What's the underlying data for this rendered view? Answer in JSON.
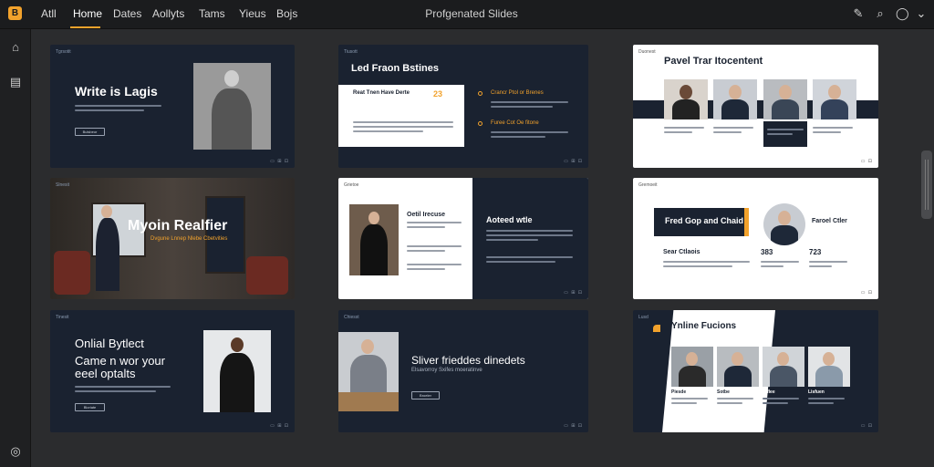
{
  "app": {
    "logo_glyph": "B",
    "title": "Profgenated Slides",
    "accent_color": "#f2a22c"
  },
  "nav": {
    "tabs": [
      {
        "label": "Atll"
      },
      {
        "label": "Home"
      },
      {
        "label": "Dates"
      },
      {
        "label": "Aollyts"
      },
      {
        "label": "Tams"
      },
      {
        "label": "Yieus"
      },
      {
        "label": "Bojs"
      }
    ],
    "active_tab": "Home"
  },
  "toolbar": {
    "icons": [
      "edit-icon",
      "search-icon",
      "chat-icon",
      "chevron-down-icon"
    ]
  },
  "sidebar": {
    "icons": [
      "slides-icon",
      "folder-icon",
      "settings-icon"
    ]
  },
  "cards": {
    "c1": {
      "tag": "Tgrsotit",
      "title": "Write is Lagis",
      "button": "Bulsbeor"
    },
    "c2": {
      "tag": "Tiusott",
      "title": "Led Fraon Bstines",
      "panel_title": "Reat Tnen Have Derte",
      "panel_num": "23",
      "right1": "Crancr Ptol or Brenes",
      "right2": "Furee Cot Oe fitone"
    },
    "c3": {
      "tag": "Duonest",
      "title": "Pavel Trar Itocentent"
    },
    "c4": {
      "tag": "Slnesit",
      "title": "Myoin Realfier",
      "subtitle": "Dvgune Lnnep Nlebe Cbetvities"
    },
    "c5": {
      "tag": "Grietoe",
      "title": "Oetil Irecuse",
      "right_title": "Aoteed wtle"
    },
    "c6": {
      "tag": "Gremoeit",
      "banner": "Fred Gop and Chaid",
      "right_title": "Faroel Ctler",
      "metric_label": "Sear Ctlaois",
      "metric1": "383",
      "metric2": "723"
    },
    "c7": {
      "tag": "Tinesit",
      "title": "Onlial Bytlect",
      "subtitle": "Came n wor your eeel optalts",
      "button": "Bloriate"
    },
    "c8": {
      "tag": "Chiesst",
      "title": "Sliver frieddes dinedets",
      "subtitle": "Elsavorroy Sxifes moeratinve",
      "button": "Broeler"
    },
    "c9": {
      "tag": "Lusd",
      "title": "Ynline Fucions",
      "labels": [
        "Piesde",
        "Sotbe",
        "Biflee",
        "Lisfuen"
      ]
    }
  }
}
